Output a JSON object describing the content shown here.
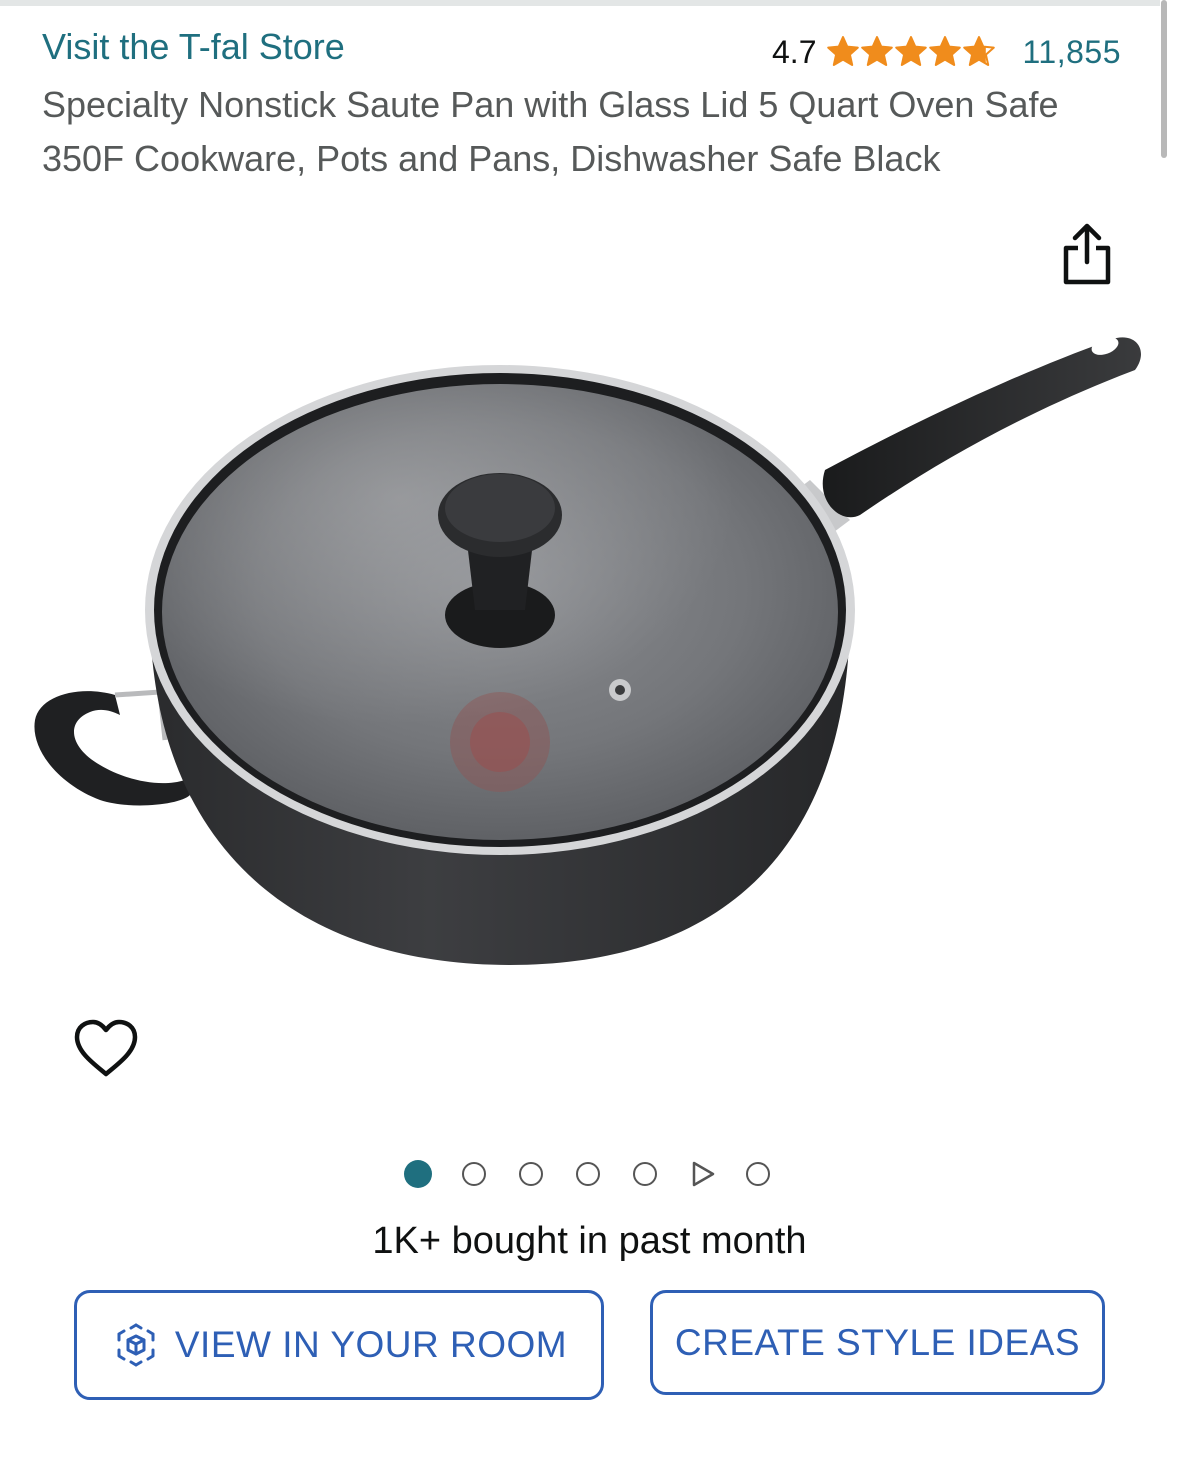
{
  "store": {
    "link_label": "Visit the T-fal Store"
  },
  "rating": {
    "value": "4.7",
    "stars_filled": 4.7,
    "stars_total": 5,
    "review_count": "11,855"
  },
  "product": {
    "title": "Specialty Nonstick Saute Pan with Glass Lid 5 Quart Oven Safe 350F Cookware, Pots and Pans, Dishwasher Safe Black"
  },
  "gallery": {
    "image_count": 7,
    "active_index": 0,
    "video_index": 5,
    "image_alt": "T-fal specialty nonstick saute pan with glass lid"
  },
  "icons": {
    "share": "share-icon",
    "wishlist": "heart-icon",
    "view_in_room": "cube-ar-icon",
    "star": "star-icon"
  },
  "social_proof": {
    "text": "1K+ bought in past month"
  },
  "actions": {
    "view_in_room_label": "VIEW IN YOUR ROOM",
    "create_style_label": "CREATE STYLE IDEAS"
  },
  "colors": {
    "link": "#1f6f7f",
    "star": "#f08c1c",
    "button_accent": "#2e5fb5",
    "title_gray": "#565959"
  }
}
